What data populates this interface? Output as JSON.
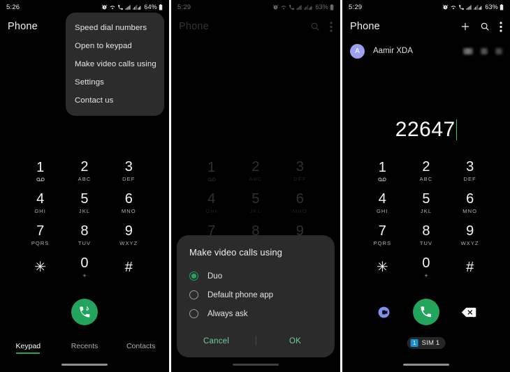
{
  "meta": {
    "app_name": "Phone",
    "accent_green": "#22a45d",
    "avatar_purple": "#9ca0ef",
    "duo_blue": "#7c8ef0",
    "sim_blue": "#1d8fd1"
  },
  "keypad": {
    "keys": [
      {
        "digit": "1",
        "sub": "",
        "icon": "voicemail-icon"
      },
      {
        "digit": "2",
        "sub": "ABC",
        "icon": ""
      },
      {
        "digit": "3",
        "sub": "DEF",
        "icon": ""
      },
      {
        "digit": "4",
        "sub": "GHI",
        "icon": ""
      },
      {
        "digit": "5",
        "sub": "JKL",
        "icon": ""
      },
      {
        "digit": "6",
        "sub": "MNO",
        "icon": ""
      },
      {
        "digit": "7",
        "sub": "PQRS",
        "icon": ""
      },
      {
        "digit": "8",
        "sub": "TUV",
        "icon": ""
      },
      {
        "digit": "9",
        "sub": "WXYZ",
        "icon": ""
      },
      {
        "digit": "✳",
        "sub": "",
        "icon": ""
      },
      {
        "digit": "0",
        "sub": "+",
        "icon": ""
      },
      {
        "digit": "#",
        "sub": "",
        "icon": ""
      }
    ]
  },
  "panel1": {
    "status": {
      "time": "5:26",
      "battery": "64%"
    },
    "title": "Phone",
    "overflow_menu": {
      "items": [
        "Speed dial numbers",
        "Open to keypad",
        "Make video calls using",
        "Settings",
        "Contact us"
      ]
    },
    "call_button": "wifi-call-icon",
    "tabs": [
      {
        "label": "Keypad",
        "active": true
      },
      {
        "label": "Recents",
        "active": false
      },
      {
        "label": "Contacts",
        "active": false
      }
    ]
  },
  "panel2": {
    "status": {
      "time": "5:29",
      "battery": "63%"
    },
    "title": "Phone",
    "actions": [
      "search-icon",
      "overflow-menu-icon"
    ],
    "dialog": {
      "title": "Make video calls using",
      "options": [
        {
          "label": "Duo",
          "selected": true
        },
        {
          "label": "Default phone app",
          "selected": false
        },
        {
          "label": "Always ask",
          "selected": false
        }
      ],
      "cancel_label": "Cancel",
      "ok_label": "OK"
    }
  },
  "panel3": {
    "status": {
      "time": "5:29",
      "battery": "63%"
    },
    "title": "Phone",
    "actions": [
      "add-contact-icon",
      "search-icon",
      "overflow-menu-icon"
    ],
    "contact": {
      "avatar_initial": "A",
      "name": "Aamir XDA",
      "redacted_action_count": 3
    },
    "dialed_number": "22647",
    "action_buttons": {
      "video_call": "duo-video-call-icon",
      "call": "call-icon",
      "backspace": "backspace-icon"
    },
    "sim": {
      "badge": "1",
      "label": "SIM 1"
    }
  }
}
